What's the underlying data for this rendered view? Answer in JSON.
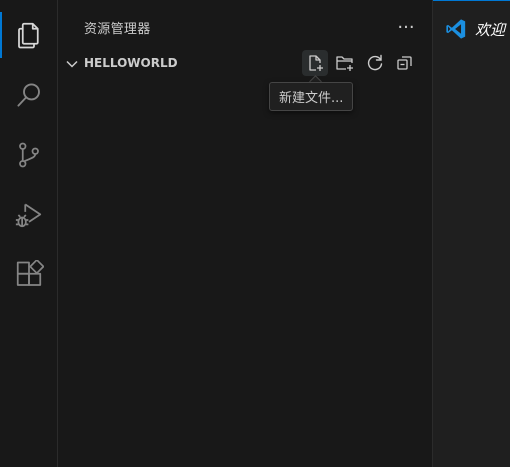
{
  "activity_bar": {
    "items": [
      {
        "name": "explorer",
        "icon": "files-icon",
        "active": true
      },
      {
        "name": "search",
        "icon": "search-icon",
        "active": false
      },
      {
        "name": "source-control",
        "icon": "source-control-icon",
        "active": false
      },
      {
        "name": "run-debug",
        "icon": "run-debug-icon",
        "active": false
      },
      {
        "name": "extensions",
        "icon": "extensions-icon",
        "active": false
      }
    ]
  },
  "sidebar": {
    "title": "资源管理器",
    "more_label": "···",
    "folder": {
      "name": "HELLOWORLD",
      "actions": [
        {
          "name": "new-file",
          "icon": "new-file-icon"
        },
        {
          "name": "new-folder",
          "icon": "new-folder-icon"
        },
        {
          "name": "refresh",
          "icon": "refresh-icon"
        },
        {
          "name": "collapse-all",
          "icon": "collapse-all-icon"
        }
      ]
    },
    "tooltip": "新建文件..."
  },
  "editor": {
    "tab": {
      "label": "欢迎",
      "icon": "vscode-logo-icon"
    }
  },
  "colors": {
    "accent": "#0078d4",
    "background": "#181818",
    "text": "#cccccc",
    "icon_inactive": "#858585"
  }
}
